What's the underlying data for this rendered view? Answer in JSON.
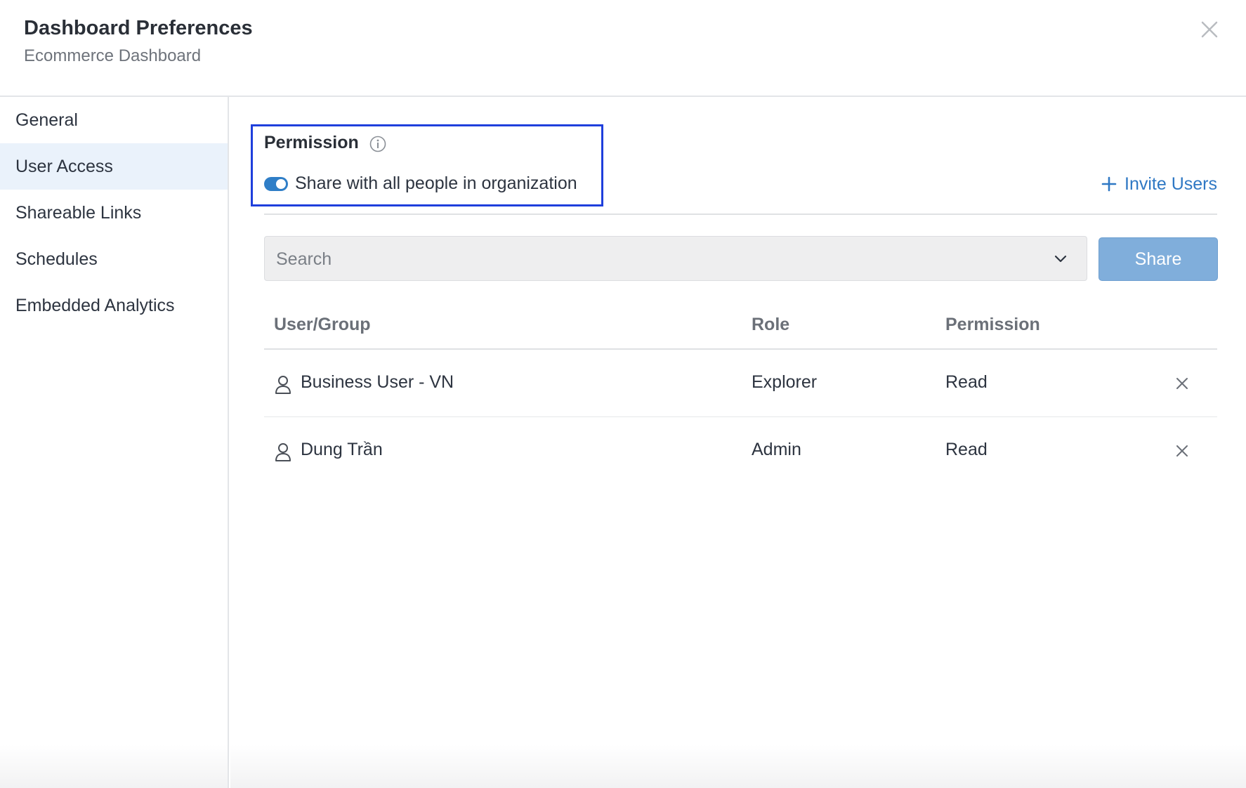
{
  "header": {
    "title": "Dashboard Preferences",
    "subtitle": "Ecommerce Dashboard",
    "close_icon": "close-icon"
  },
  "sidebar": {
    "items": [
      {
        "label": "General",
        "active": false
      },
      {
        "label": "User Access",
        "active": true
      },
      {
        "label": "Shareable Links",
        "active": false
      },
      {
        "label": "Schedules",
        "active": false
      },
      {
        "label": "Embedded Analytics",
        "active": false
      }
    ]
  },
  "permission": {
    "title": "Permission",
    "info_icon": "info-icon",
    "share_all_label": "Share with all people in organization",
    "share_all_enabled": true
  },
  "invite": {
    "label": "Invite Users",
    "icon": "plus-icon"
  },
  "search": {
    "placeholder": "Search",
    "value": "",
    "dropdown_icon": "chevron-down-icon"
  },
  "share_button": {
    "label": "Share"
  },
  "table": {
    "columns": [
      "User/Group",
      "Role",
      "Permission"
    ],
    "rows": [
      {
        "name": "Business User - VN",
        "role": "Explorer",
        "permission": "Read"
      },
      {
        "name": "Dung Trần",
        "role": "Admin",
        "permission": "Read"
      }
    ]
  },
  "colors": {
    "accent": "#2f7ec7",
    "link": "#2f78c4",
    "share_button_bg": "#80aedb",
    "highlight_border": "#1f3fdc",
    "active_nav_bg": "#eaf2fb"
  }
}
